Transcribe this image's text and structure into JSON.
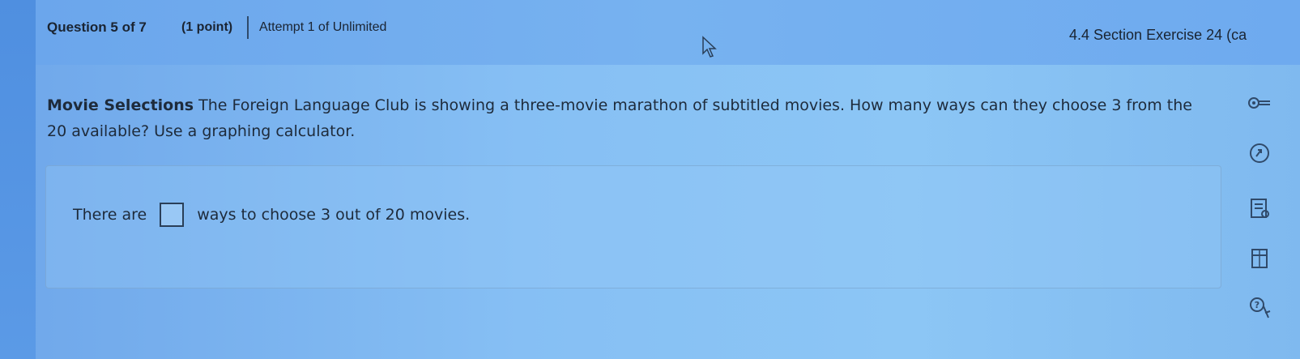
{
  "header": {
    "question_number": "Question 5 of 7",
    "points": "(1 point)",
    "attempt": "Attempt 1 of Unlimited",
    "section": "4.4 Section Exercise 24 (ca"
  },
  "question": {
    "title": "Movie Selections",
    "body": " The Foreign Language Club is showing a three-movie marathon of subtitled movies. How many ways can they choose 3 from the 20 available? Use a graphing calculator."
  },
  "answer": {
    "prefix": "There are",
    "suffix": "ways to choose 3 out of 20 movies.",
    "value": ""
  },
  "toolbar": {
    "icons": [
      "key-icon",
      "rotate-icon",
      "notes-icon",
      "calculator-icon",
      "help-icon"
    ]
  }
}
